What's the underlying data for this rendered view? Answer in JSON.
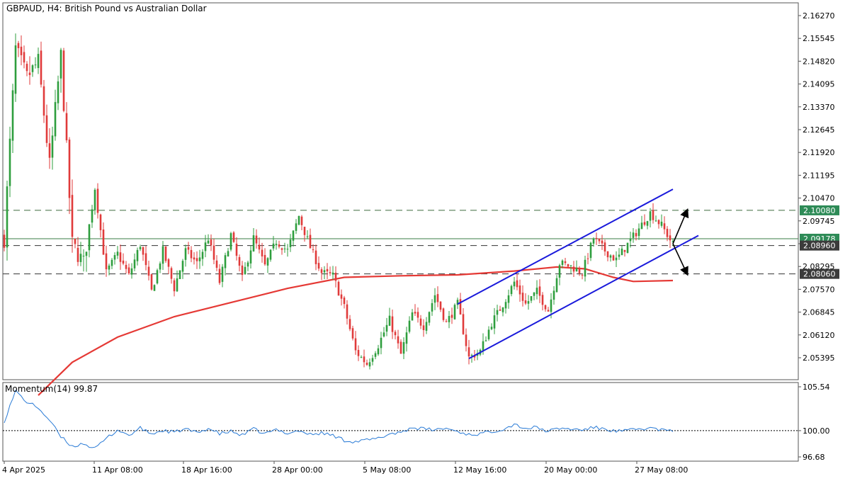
{
  "header": {
    "symbol_title": "GBPAUD, H4:  British Pound vs Australian Dollar"
  },
  "colors": {
    "bull": "#26a69a",
    "bull_candle": "#2e9e3e",
    "bear": "#e03a3a",
    "ma": "#e53935",
    "channel": "#1a1adb",
    "level": "#3d6b3d",
    "momentum": "#2a7bd6",
    "frame": "#555555",
    "badge_green": "#2e8b57",
    "badge_dark": "#3b3b3b"
  },
  "chart_data": [
    {
      "type": "candlestick",
      "name": "price-pane",
      "title": "GBPAUD, H4:  British Pound vs Australian Dollar",
      "ylim": [
        2.05,
        2.1665
      ],
      "y_ticks": [
        "2.16270",
        "2.15545",
        "2.14820",
        "2.14095",
        "2.13370",
        "2.12645",
        "2.11920",
        "2.11195",
        "2.10470",
        "2.09745",
        "2.09020",
        "2.08295",
        "2.07570",
        "2.06845",
        "2.06120",
        "2.05395"
      ],
      "price_badges": [
        {
          "label": "2.10080",
          "value": 2.1008,
          "style": "green"
        },
        {
          "label": "2.09178",
          "value": 2.09178,
          "style": "green"
        },
        {
          "label": "2.08960",
          "value": 2.0896,
          "style": "dark"
        },
        {
          "label": "2.08060",
          "value": 2.0806,
          "style": "dark"
        }
      ],
      "horizontal_levels": [
        2.1008,
        2.0896,
        2.0806
      ],
      "bid_line": 2.09178,
      "x_tick_labels": [
        "4 Apr 2025",
        "11 Apr 08:00",
        "18 Apr 16:00",
        "28 Apr 00:00",
        "5 May 08:00",
        "12 May 16:00",
        "20 May 00:00",
        "27 May 08:00"
      ],
      "anchors": [
        {
          "bar": 0,
          "price": 2.092
        },
        {
          "bar": 4,
          "price": 2.152
        },
        {
          "bar": 8,
          "price": 2.143
        },
        {
          "bar": 12,
          "price": 2.148
        },
        {
          "bar": 16,
          "price": 2.115
        },
        {
          "bar": 20,
          "price": 2.15
        },
        {
          "bar": 24,
          "price": 2.09
        },
        {
          "bar": 28,
          "price": 2.084
        },
        {
          "bar": 32,
          "price": 2.108
        },
        {
          "bar": 36,
          "price": 2.081
        },
        {
          "bar": 40,
          "price": 2.087
        },
        {
          "bar": 44,
          "price": 2.08
        },
        {
          "bar": 48,
          "price": 2.09
        },
        {
          "bar": 52,
          "price": 2.075
        },
        {
          "bar": 56,
          "price": 2.088
        },
        {
          "bar": 60,
          "price": 2.076
        },
        {
          "bar": 64,
          "price": 2.088
        },
        {
          "bar": 68,
          "price": 2.084
        },
        {
          "bar": 72,
          "price": 2.092
        },
        {
          "bar": 76,
          "price": 2.078
        },
        {
          "bar": 80,
          "price": 2.093
        },
        {
          "bar": 84,
          "price": 2.079
        },
        {
          "bar": 88,
          "price": 2.092
        },
        {
          "bar": 92,
          "price": 2.083
        },
        {
          "bar": 96,
          "price": 2.091
        },
        {
          "bar": 100,
          "price": 2.088
        },
        {
          "bar": 104,
          "price": 2.099
        },
        {
          "bar": 108,
          "price": 2.089
        },
        {
          "bar": 112,
          "price": 2.081
        },
        {
          "bar": 116,
          "price": 2.08
        },
        {
          "bar": 120,
          "price": 2.07
        },
        {
          "bar": 124,
          "price": 2.056
        },
        {
          "bar": 128,
          "price": 2.052
        },
        {
          "bar": 132,
          "price": 2.058
        },
        {
          "bar": 136,
          "price": 2.066
        },
        {
          "bar": 140,
          "price": 2.055
        },
        {
          "bar": 144,
          "price": 2.068
        },
        {
          "bar": 148,
          "price": 2.064
        },
        {
          "bar": 152,
          "price": 2.074
        },
        {
          "bar": 156,
          "price": 2.065
        },
        {
          "bar": 160,
          "price": 2.071
        },
        {
          "bar": 164,
          "price": 2.054
        },
        {
          "bar": 168,
          "price": 2.056
        },
        {
          "bar": 172,
          "price": 2.065
        },
        {
          "bar": 176,
          "price": 2.071
        },
        {
          "bar": 180,
          "price": 2.078
        },
        {
          "bar": 184,
          "price": 2.071
        },
        {
          "bar": 188,
          "price": 2.075
        },
        {
          "bar": 192,
          "price": 2.069
        },
        {
          "bar": 196,
          "price": 2.084
        },
        {
          "bar": 200,
          "price": 2.083
        },
        {
          "bar": 204,
          "price": 2.081
        },
        {
          "bar": 208,
          "price": 2.092
        },
        {
          "bar": 212,
          "price": 2.088
        },
        {
          "bar": 216,
          "price": 2.085
        },
        {
          "bar": 220,
          "price": 2.09
        },
        {
          "bar": 224,
          "price": 2.095
        },
        {
          "bar": 228,
          "price": 2.1
        },
        {
          "bar": 232,
          "price": 2.096
        },
        {
          "bar": 236,
          "price": 2.09
        }
      ],
      "moving_average": [
        {
          "bar": 12,
          "price": 2.042
        },
        {
          "bar": 24,
          "price": 2.0525
        },
        {
          "bar": 40,
          "price": 2.0605
        },
        {
          "bar": 60,
          "price": 2.067
        },
        {
          "bar": 80,
          "price": 2.0715
        },
        {
          "bar": 100,
          "price": 2.076
        },
        {
          "bar": 120,
          "price": 2.0795
        },
        {
          "bar": 140,
          "price": 2.08
        },
        {
          "bar": 160,
          "price": 2.0803
        },
        {
          "bar": 180,
          "price": 2.0815
        },
        {
          "bar": 195,
          "price": 2.0828
        },
        {
          "bar": 205,
          "price": 2.0822
        },
        {
          "bar": 215,
          "price": 2.0795
        },
        {
          "bar": 222,
          "price": 2.0782
        },
        {
          "bar": 236,
          "price": 2.0785
        }
      ],
      "channel": {
        "upper": {
          "start": {
            "bar": 160,
            "price": 2.071
          },
          "end": {
            "bar": 236,
            "price": 2.1075
          }
        },
        "lower": {
          "start": {
            "bar": 164,
            "price": 2.0537
          },
          "end": {
            "bar": 245,
            "price": 2.0928
          }
        }
      },
      "scenario_arrows": {
        "origin": {
          "bar": 236,
          "price": 2.0902
        },
        "up": {
          "bar": 241,
          "price": 2.1008
        },
        "down": {
          "bar": 241,
          "price": 2.0806
        }
      }
    },
    {
      "type": "line",
      "name": "momentum-pane",
      "title": "Momentum(14) 99.87",
      "ylim": [
        96.68,
        105.54
      ],
      "y_ticks": [
        "105.54",
        "100.00",
        "96.68"
      ],
      "reference_level": 100.0,
      "anchors": [
        {
          "bar": 0,
          "value": 101.2
        },
        {
          "bar": 4,
          "value": 105.0
        },
        {
          "bar": 8,
          "value": 103.6
        },
        {
          "bar": 12,
          "value": 102.9
        },
        {
          "bar": 16,
          "value": 101.3
        },
        {
          "bar": 20,
          "value": 99.2
        },
        {
          "bar": 24,
          "value": 98.0
        },
        {
          "bar": 28,
          "value": 98.4
        },
        {
          "bar": 32,
          "value": 97.7
        },
        {
          "bar": 36,
          "value": 99.0
        },
        {
          "bar": 40,
          "value": 100.1
        },
        {
          "bar": 44,
          "value": 99.4
        },
        {
          "bar": 48,
          "value": 100.3
        },
        {
          "bar": 52,
          "value": 99.6
        },
        {
          "bar": 56,
          "value": 100.0
        },
        {
          "bar": 60,
          "value": 99.8
        },
        {
          "bar": 64,
          "value": 100.2
        },
        {
          "bar": 68,
          "value": 99.7
        },
        {
          "bar": 72,
          "value": 100.3
        },
        {
          "bar": 76,
          "value": 99.6
        },
        {
          "bar": 80,
          "value": 99.9
        },
        {
          "bar": 84,
          "value": 99.4
        },
        {
          "bar": 88,
          "value": 100.2
        },
        {
          "bar": 92,
          "value": 99.6
        },
        {
          "bar": 96,
          "value": 100.1
        },
        {
          "bar": 100,
          "value": 99.7
        },
        {
          "bar": 104,
          "value": 100.0
        },
        {
          "bar": 108,
          "value": 99.5
        },
        {
          "bar": 112,
          "value": 99.7
        },
        {
          "bar": 116,
          "value": 99.4
        },
        {
          "bar": 120,
          "value": 98.8
        },
        {
          "bar": 124,
          "value": 98.6
        },
        {
          "bar": 128,
          "value": 98.8
        },
        {
          "bar": 132,
          "value": 99.0
        },
        {
          "bar": 136,
          "value": 99.6
        },
        {
          "bar": 140,
          "value": 99.8
        },
        {
          "bar": 144,
          "value": 100.4
        },
        {
          "bar": 148,
          "value": 100.2
        },
        {
          "bar": 152,
          "value": 100.1
        },
        {
          "bar": 156,
          "value": 100.3
        },
        {
          "bar": 160,
          "value": 99.9
        },
        {
          "bar": 164,
          "value": 99.5
        },
        {
          "bar": 168,
          "value": 99.6
        },
        {
          "bar": 172,
          "value": 99.9
        },
        {
          "bar": 176,
          "value": 100.2
        },
        {
          "bar": 180,
          "value": 100.8
        },
        {
          "bar": 184,
          "value": 100.3
        },
        {
          "bar": 188,
          "value": 100.4
        },
        {
          "bar": 192,
          "value": 99.9
        },
        {
          "bar": 196,
          "value": 100.3
        },
        {
          "bar": 200,
          "value": 100.2
        },
        {
          "bar": 204,
          "value": 100.1
        },
        {
          "bar": 208,
          "value": 100.4
        },
        {
          "bar": 212,
          "value": 100.2
        },
        {
          "bar": 216,
          "value": 99.9
        },
        {
          "bar": 220,
          "value": 100.0
        },
        {
          "bar": 224,
          "value": 100.2
        },
        {
          "bar": 228,
          "value": 100.3
        },
        {
          "bar": 232,
          "value": 100.1
        },
        {
          "bar": 236,
          "value": 99.87
        }
      ]
    }
  ]
}
